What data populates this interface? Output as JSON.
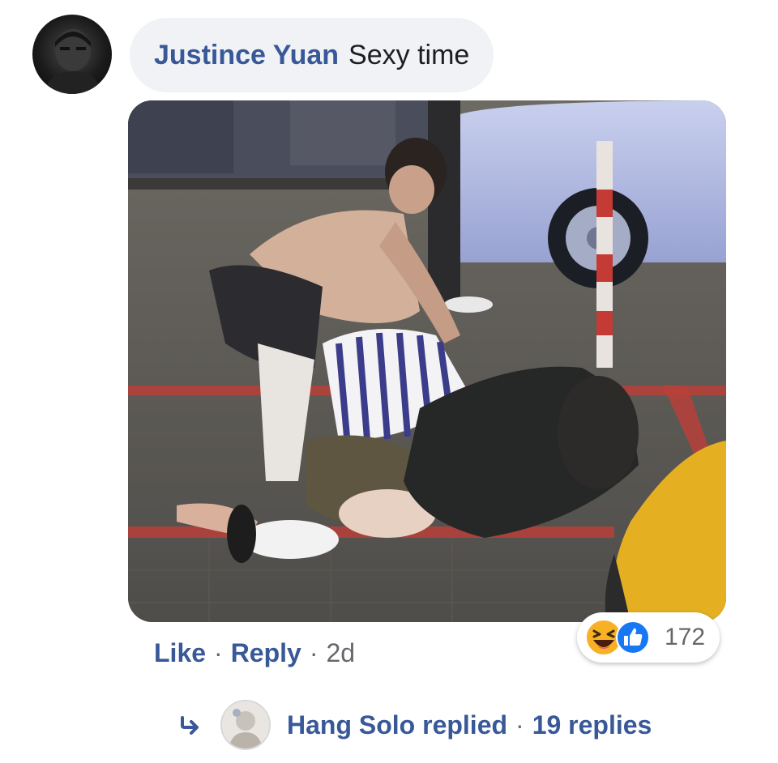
{
  "comment": {
    "author": "Justince Yuan",
    "text": "Sexy time",
    "avatar_icon": "user-avatar",
    "attachment_icon": "street-scene-photo"
  },
  "actions": {
    "like_label": "Like",
    "reply_label": "Reply",
    "separator": "·",
    "age": "2d"
  },
  "reactions": {
    "icons": [
      "haha-reaction-icon",
      "like-reaction-icon"
    ],
    "count": "172",
    "haha_color": "#f7b125",
    "like_color": "#1877f2"
  },
  "replies": {
    "arrow_icon": "reply-arrow-icon",
    "summary": "Hang Solo replied",
    "separator": "·",
    "count": "19 replies"
  },
  "colors": {
    "link": "#385898",
    "muted": "#65676b",
    "bubble": "#f0f2f5"
  }
}
